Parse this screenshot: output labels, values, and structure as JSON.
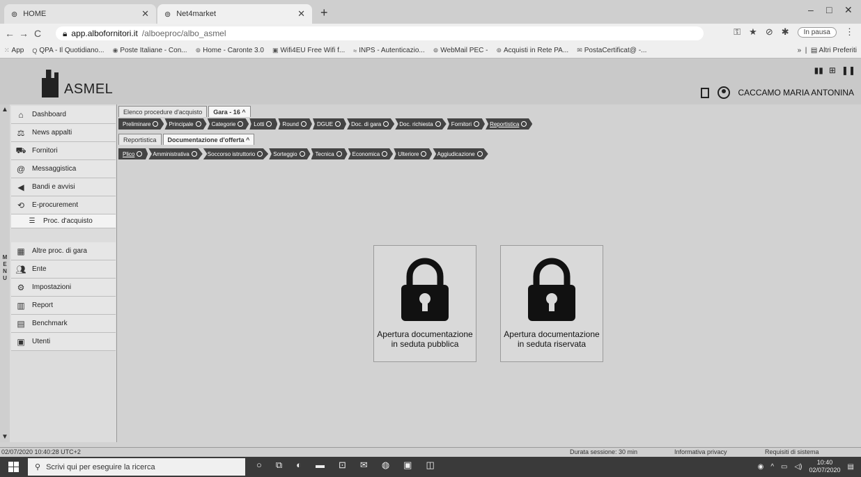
{
  "browser": {
    "tabs": [
      {
        "title": "HOME",
        "icon": "globe-icon"
      },
      {
        "title": "Net4market",
        "icon": "globe-icon"
      }
    ],
    "url_host": "app.albofornitori.it",
    "url_path": "/alboeproc/albo_asmel",
    "pause_label": "In pausa",
    "bookmarks": [
      "App",
      "QPA - Il Quotidiano...",
      "Poste Italiane - Con...",
      "Home - Caronte 3.0",
      "Wifi4EU Free Wifi f...",
      "INPS - Autenticazio...",
      "WebMail PEC -",
      "Acquisti in Rete PA...",
      "PostaCertificat@ -..."
    ],
    "bookmarks_more": "»",
    "other_bookmarks": "Altri Preferiti"
  },
  "header": {
    "logo_text": "ASMEL",
    "user_name": "CACCAMO MARIA ANTONINA"
  },
  "sidebar": {
    "vertical_label": [
      "M",
      "E",
      "N",
      "U"
    ],
    "items": [
      {
        "label": "Dashboard",
        "icon": "home-icon"
      },
      {
        "label": "News appalti",
        "icon": "scales-icon"
      },
      {
        "label": "Fornitori",
        "icon": "truck-icon"
      },
      {
        "label": "Messaggistica",
        "icon": "at-icon"
      },
      {
        "label": "Bandi e avvisi",
        "icon": "megaphone-icon"
      },
      {
        "label": "E-procurement",
        "icon": "cart-icon"
      },
      {
        "label": "Proc. d'acquisto",
        "icon": "list-icon"
      },
      {
        "label": "Altre proc. di gara",
        "icon": "box-icon"
      },
      {
        "label": "Ente",
        "icon": "people-icon"
      },
      {
        "label": "Impostazioni",
        "icon": "gear-icon"
      },
      {
        "label": "Report",
        "icon": "chart-icon"
      },
      {
        "label": "Benchmark",
        "icon": "document-icon"
      },
      {
        "label": "Utenti",
        "icon": "user-card-icon"
      }
    ]
  },
  "workspace": {
    "top_tabs": [
      "Elenco procedure d'acquisto",
      "Gara - 16 ^"
    ],
    "steps_main": [
      "Preliminare",
      "Principale",
      "Categorie",
      "Lotti",
      "Round",
      "DGUE",
      "Doc. di gara",
      "Doc. richiesta",
      "Fornitori",
      "Reportistica"
    ],
    "sub_tabs": [
      "Reportistica",
      "Documentazione d'offerta ^"
    ],
    "steps_sub": [
      "Plico",
      "Amministrativa",
      "Soccorso istruttorio",
      "Sorteggio",
      "Tecnica",
      "Economica",
      "Ulteriore",
      "Aggiudicazione"
    ],
    "cards": [
      {
        "label": "Apertura documentazione in seduta pubblica",
        "icon": "padlock-icon"
      },
      {
        "label": "Apertura documentazione in seduta riservata",
        "icon": "padlock-icon"
      }
    ]
  },
  "statusbar": {
    "timestamp": "02/07/2020 10:40:28 UTC+2",
    "session": "Durata sessione: 30 min",
    "privacy": "Informativa privacy",
    "requirements": "Requisiti di sistema"
  },
  "taskbar": {
    "search_placeholder": "Scrivi qui per eseguire la ricerca",
    "time": "10:40",
    "date": "02/07/2020"
  }
}
